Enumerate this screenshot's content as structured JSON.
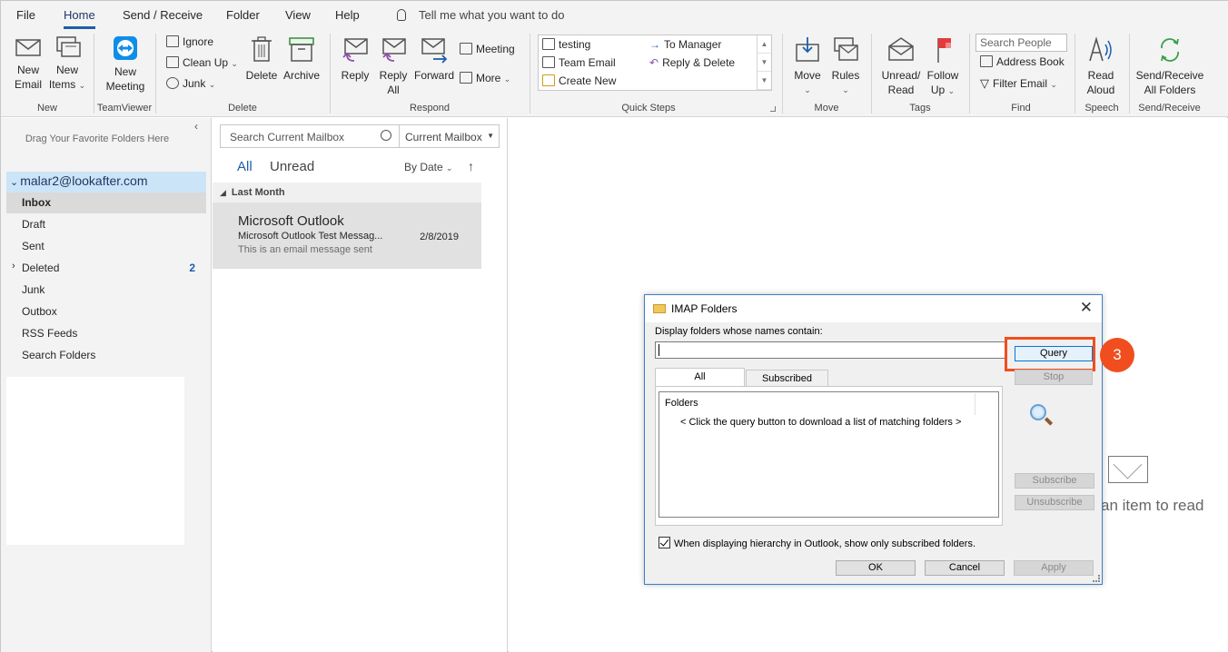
{
  "menu": {
    "items": [
      "File",
      "Home",
      "Send / Receive",
      "Folder",
      "View",
      "Help"
    ],
    "tell_me": "Tell me what you want to do"
  },
  "ribbon": {
    "new": {
      "new_email": [
        "New",
        "Email"
      ],
      "new_items": [
        "New",
        "Items"
      ],
      "group": "New"
    },
    "teamviewer": {
      "new_meeting": [
        "New",
        "Meeting"
      ],
      "group": "TeamViewer"
    },
    "delete": {
      "ignore": "Ignore",
      "clean_up": "Clean Up",
      "junk": "Junk",
      "delete": "Delete",
      "archive": "Archive",
      "group": "Delete"
    },
    "respond": {
      "reply": "Reply",
      "reply_all": [
        "Reply",
        "All"
      ],
      "forward": "Forward",
      "meeting": "Meeting",
      "more": "More",
      "group": "Respond"
    },
    "quick_steps": {
      "items": [
        "testing",
        "Team Email",
        "Create New",
        "To Manager",
        "Reply & Delete"
      ],
      "group": "Quick Steps"
    },
    "move": {
      "move": "Move",
      "rules": "Rules",
      "group": "Move"
    },
    "tags": {
      "unread_read": [
        "Unread/",
        "Read"
      ],
      "follow_up": [
        "Follow",
        "Up"
      ],
      "group": "Tags"
    },
    "find": {
      "search_people": "Search People",
      "address_book": "Address Book",
      "filter_email": "Filter Email",
      "group": "Find"
    },
    "speech": {
      "read_aloud": [
        "Read",
        "Aloud"
      ],
      "group": "Speech"
    },
    "send_receive": {
      "all_folders": [
        "Send/Receive",
        "All Folders"
      ],
      "group": "Send/Receive"
    }
  },
  "folder_pane": {
    "favorites_hint": "Drag Your Favorite Folders Here",
    "account": "malar2@lookafter.com",
    "folders": [
      {
        "label": "Inbox",
        "count": ""
      },
      {
        "label": "Draft",
        "count": ""
      },
      {
        "label": "Sent",
        "count": ""
      },
      {
        "label": "Deleted",
        "count": "2"
      },
      {
        "label": "Junk",
        "count": ""
      },
      {
        "label": "Outbox",
        "count": ""
      },
      {
        "label": "RSS Feeds",
        "count": ""
      },
      {
        "label": "Search Folders",
        "count": ""
      }
    ]
  },
  "message_list": {
    "search_placeholder": "Search Current Mailbox",
    "scope": "Current Mailbox",
    "filter_all": "All",
    "filter_unread": "Unread",
    "sort": "By Date",
    "group_header": "Last Month",
    "messages": [
      {
        "sender": "Microsoft Outlook",
        "subject": "Microsoft Outlook Test Messag...",
        "preview": "This is an email message sent",
        "date": "2/8/2019"
      }
    ]
  },
  "reading_pane": {
    "text": "an item to read"
  },
  "dialog": {
    "title": "IMAP Folders",
    "label": "Display folders whose names contain:",
    "input_value": "",
    "query": "Query",
    "stop": "Stop",
    "tab_all": "All",
    "tab_subscribed": "Subscribed",
    "list_header": "Folders",
    "list_message": "< Click the query button to download a list of matching folders >",
    "subscribe": "Subscribe",
    "unsubscribe": "Unsubscribe",
    "checkbox_label": "When displaying hierarchy in Outlook, show only subscribed folders.",
    "ok": "OK",
    "cancel": "Cancel",
    "apply": "Apply",
    "step_badge": "3"
  },
  "colors": {
    "accent": "#1f5ea8",
    "highlight": "#f04e1f",
    "selection": "#cce4f7"
  }
}
